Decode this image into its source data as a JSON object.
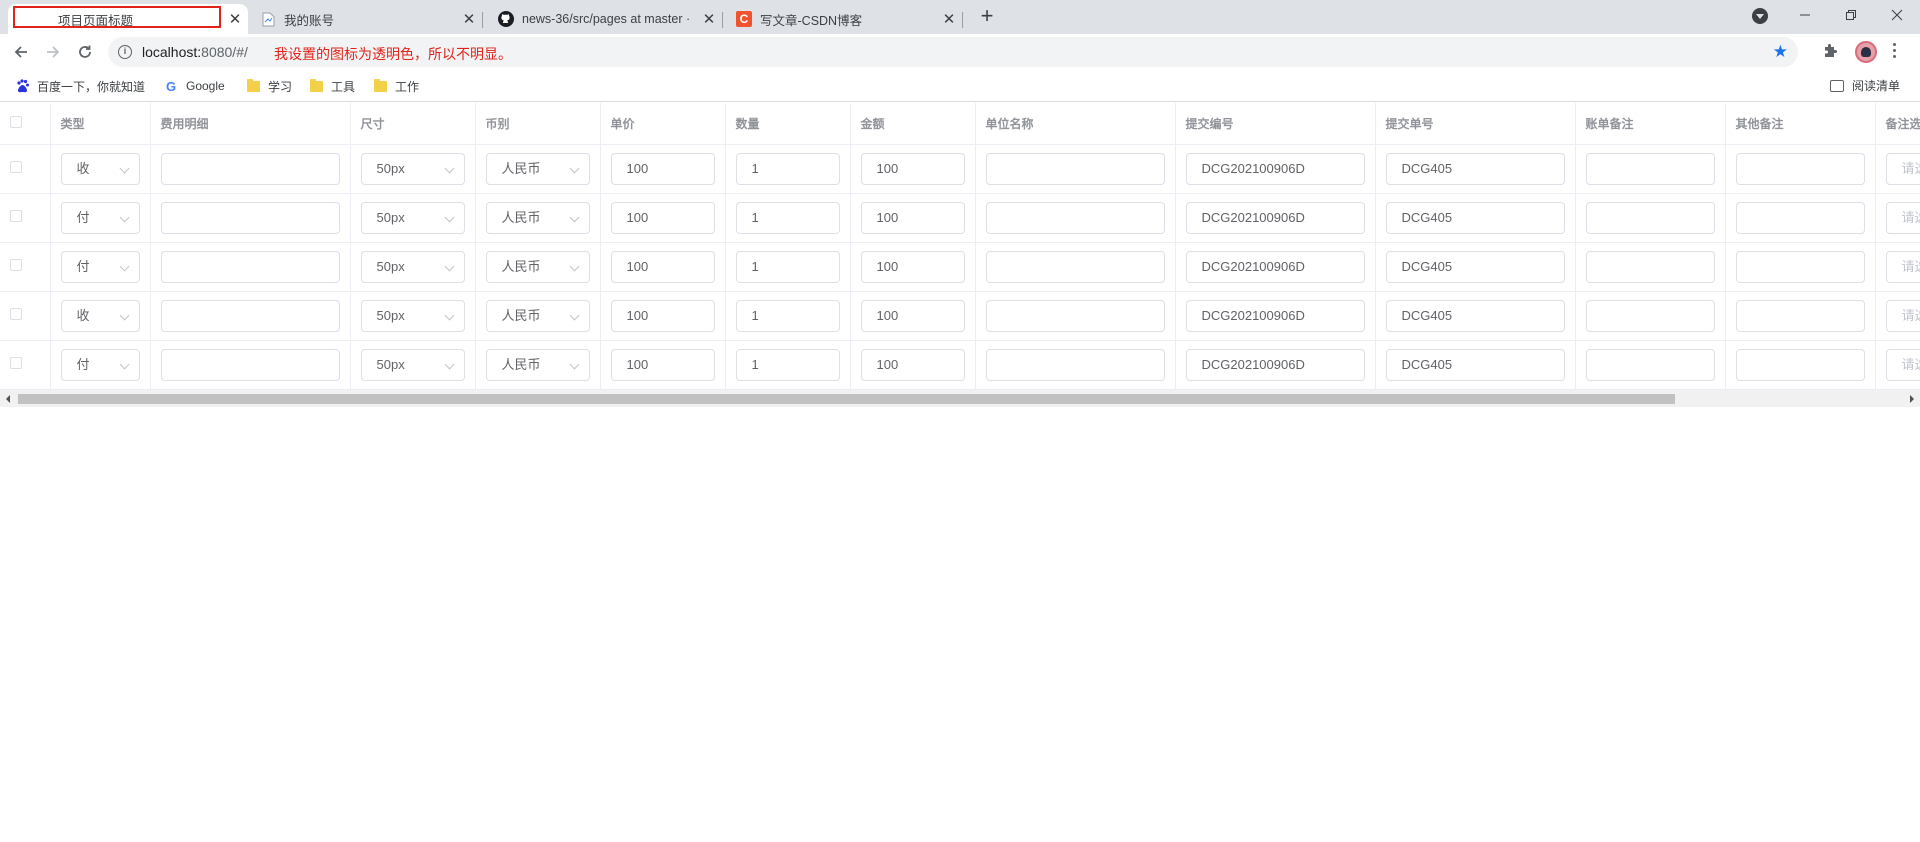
{
  "browser": {
    "tabs": [
      {
        "title": "项目页面标题",
        "active": true
      },
      {
        "title": "我的账号",
        "active": false
      },
      {
        "title": "news-36/src/pages at master ·",
        "active": false
      },
      {
        "title": "写文章-CSDN博客",
        "active": false
      }
    ],
    "url_host": "localhost:",
    "url_path": "8080/#/",
    "annotation": "我设置的图标为透明色，所以不明显。"
  },
  "bookmarks": {
    "items": [
      "百度一下，你就知道",
      "Google",
      "学习",
      "工具",
      "工作"
    ],
    "reading_list": "阅读清单"
  },
  "table": {
    "headers": [
      "类型",
      "费用明细",
      "尺寸",
      "币别",
      "单价",
      "数量",
      "金额",
      "单位名称",
      "提交编号",
      "提交单号",
      "账单备注",
      "其他备注",
      "备注选"
    ],
    "placeholder": "请选择",
    "rows": [
      {
        "type": "收",
        "detail": "",
        "size": "50px",
        "currency": "人民币",
        "price": "100",
        "qty": "1",
        "amount": "100",
        "unit": "",
        "sub_no": "DCG202100906D",
        "sub_order": "DCG405",
        "bill_note": "",
        "other_note": ""
      },
      {
        "type": "付",
        "detail": "",
        "size": "50px",
        "currency": "人民币",
        "price": "100",
        "qty": "1",
        "amount": "100",
        "unit": "",
        "sub_no": "DCG202100906D",
        "sub_order": "DCG405",
        "bill_note": "",
        "other_note": ""
      },
      {
        "type": "付",
        "detail": "",
        "size": "50px",
        "currency": "人民币",
        "price": "100",
        "qty": "1",
        "amount": "100",
        "unit": "",
        "sub_no": "DCG202100906D",
        "sub_order": "DCG405",
        "bill_note": "",
        "other_note": ""
      },
      {
        "type": "收",
        "detail": "",
        "size": "50px",
        "currency": "人民币",
        "price": "100",
        "qty": "1",
        "amount": "100",
        "unit": "",
        "sub_no": "DCG202100906D",
        "sub_order": "DCG405",
        "bill_note": "",
        "other_note": ""
      },
      {
        "type": "付",
        "detail": "",
        "size": "50px",
        "currency": "人民币",
        "price": "100",
        "qty": "1",
        "amount": "100",
        "unit": "",
        "sub_no": "DCG202100906D",
        "sub_order": "DCG405",
        "bill_note": "",
        "other_note": ""
      }
    ]
  },
  "colors": {
    "accent": "#1a73e8",
    "annotation": "#e2231a"
  }
}
